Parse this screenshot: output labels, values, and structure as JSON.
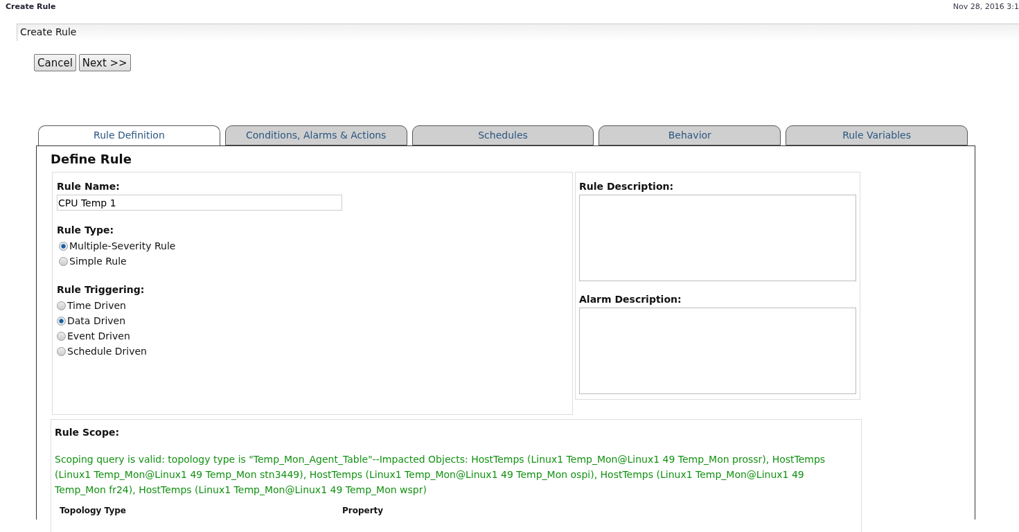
{
  "window": {
    "title": "Create Rule",
    "timestamp": "Nov 28, 2016 3:1"
  },
  "panel": {
    "title": "Create Rule"
  },
  "buttons": [
    "Cancel",
    "Next >>"
  ],
  "tabs": [
    {
      "label": "Rule Definition",
      "selected": true
    },
    {
      "label": "Conditions, Alarms & Actions",
      "selected": false
    },
    {
      "label": "Schedules",
      "selected": false
    },
    {
      "label": "Behavior",
      "selected": false
    },
    {
      "label": "Rule Variables",
      "selected": false
    }
  ],
  "section_title": "Define Rule",
  "rule_name": {
    "label": "Rule Name:",
    "value": "CPU Temp 1"
  },
  "rule_type": {
    "label": "Rule Type:",
    "options": [
      {
        "label": "Multiple-Severity Rule",
        "selected": true
      },
      {
        "label": "Simple Rule",
        "selected": false
      }
    ]
  },
  "rule_triggering": {
    "label": "Rule Triggering:",
    "options": [
      {
        "label": "Time Driven",
        "selected": false
      },
      {
        "label": "Data Driven",
        "selected": true
      },
      {
        "label": "Event Driven",
        "selected": false
      },
      {
        "label": "Schedule Driven",
        "selected": false
      }
    ]
  },
  "rule_description": {
    "label": "Rule Description:"
  },
  "alarm_description": {
    "label": "Alarm Description:"
  },
  "rule_scope": {
    "label": "Rule Scope:",
    "message": "Scoping query is valid: topology type is \"Temp_Mon_Agent_Table\"--Impacted Objects: HostTemps (Linux1 Temp_Mon@Linux1 49 Temp_Mon prossr), HostTemps (Linux1 Temp_Mon@Linux1 49 Temp_Mon stn3449), HostTemps (Linux1 Temp_Mon@Linux1 49 Temp_Mon ospi), HostTemps (Linux1 Temp_Mon@Linux1 49 Temp_Mon fr24), HostTemps (Linux1 Temp_Mon@Linux1 49 Temp_Mon wspr)",
    "columns": [
      "Topology Type",
      "Property"
    ]
  }
}
